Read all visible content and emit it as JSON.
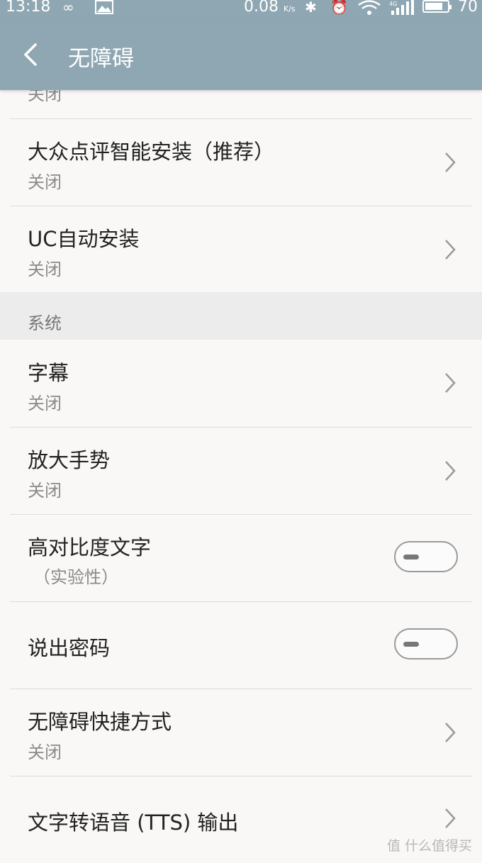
{
  "status_bar": {
    "time": "13:18",
    "net_speed": "0.08",
    "net_unit": "K/s",
    "network_type": "4G",
    "battery": "70"
  },
  "header": {
    "title": "无障碍"
  },
  "partial_row": {
    "subtitle": "关闭"
  },
  "rows_top": [
    {
      "title": "大众点评智能安装（推荐）",
      "subtitle": "关闭"
    },
    {
      "title": "UC自动安装",
      "subtitle": "关闭"
    }
  ],
  "section": {
    "label": "系统"
  },
  "rows_system": [
    {
      "title": "字幕",
      "subtitle": "关闭"
    },
    {
      "title": "放大手势",
      "subtitle": "关闭"
    },
    {
      "title": "高对比度文字",
      "subtitle": "（实验性）",
      "toggle": false
    },
    {
      "title": "说出密码",
      "toggle": false
    },
    {
      "title": "无障碍快捷方式",
      "subtitle": "关闭"
    },
    {
      "title": "文字转语音 (TTS) 输出"
    }
  ],
  "watermark": "值 什么值得买",
  "colors": {
    "header": "#8fa7b3",
    "background": "#f9f8f6",
    "section": "#ececec"
  }
}
